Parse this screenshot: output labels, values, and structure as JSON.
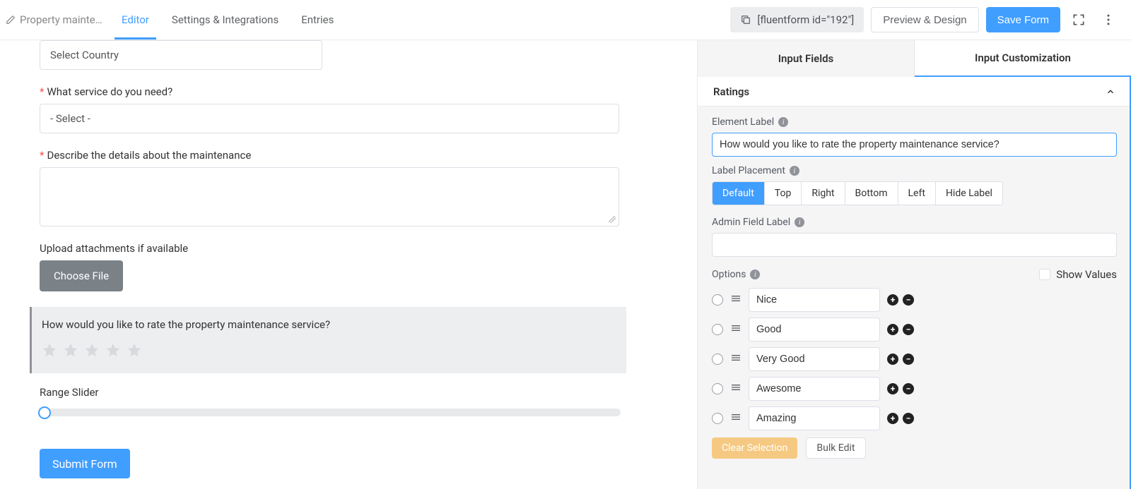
{
  "header": {
    "form_name": "Property mainte…",
    "tabs": {
      "editor": "Editor",
      "settings": "Settings & Integrations",
      "entries": "Entries"
    },
    "shortcode": "[fluentform id=\"192\"]",
    "preview_btn": "Preview & Design",
    "save_btn": "Save Form"
  },
  "canvas": {
    "country_placeholder": "Select Country",
    "service_label": "What service do you need?",
    "service_placeholder": "- Select -",
    "describe_label": "Describe the details about the maintenance",
    "upload_label": "Upload attachments if available",
    "choose_file": "Choose File",
    "rating_label": "How would you like to rate the property maintenance service?",
    "range_label": "Range Slider",
    "submit": "Submit Form"
  },
  "panel": {
    "tabs": {
      "fields": "Input Fields",
      "customization": "Input Customization"
    },
    "section": "Ratings",
    "element_label_title": "Element Label",
    "element_label_value": "How would you like to rate the property maintenance service?",
    "label_placement_title": "Label Placement",
    "placements": {
      "default": "Default",
      "top": "Top",
      "right": "Right",
      "bottom": "Bottom",
      "left": "Left",
      "hide": "Hide Label"
    },
    "admin_label_title": "Admin Field Label",
    "admin_label_value": "",
    "options_title": "Options",
    "show_values": "Show Values",
    "options": [
      {
        "label": "Nice"
      },
      {
        "label": "Good"
      },
      {
        "label": "Very Good"
      },
      {
        "label": "Awesome"
      },
      {
        "label": "Amazing"
      }
    ],
    "clear_selection": "Clear Selection",
    "bulk_edit": "Bulk Edit"
  }
}
